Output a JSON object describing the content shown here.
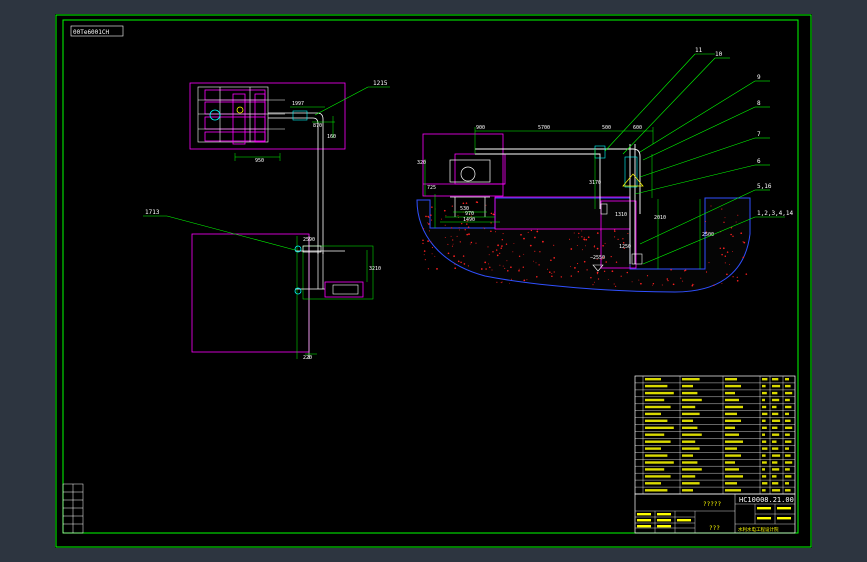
{
  "drawing": {
    "stamp": "00Те6001CH",
    "callouts": {
      "c11": "11",
      "c10": "10",
      "c9": "9",
      "c8": "8",
      "c7": "7",
      "c6": "6",
      "c516": "5,16",
      "c1214": "1,2,3,4,14",
      "c1215": "1215",
      "c1713": "1713"
    },
    "dims": {
      "d900": "900",
      "d5700": "5700",
      "d500": "500",
      "d600": "600",
      "d530": "530",
      "d970": "970",
      "d1490": "1490",
      "d3170": "3170",
      "d1310": "1310",
      "d2010": "2010",
      "d2500": "2500",
      "d1250": "1250",
      "d950": "950",
      "d1997": "1997",
      "d870": "870",
      "d320": "320",
      "d1250b": "−2550",
      "d725": "725",
      "d3210": "3210",
      "d220": "220",
      "d2590": "2590",
      "d160": "160"
    },
    "title_block": {
      "drawing_no": "HC10008.21.00",
      "name_placeholder": "?????",
      "bottom_placeholder": "???",
      "org_text": "水利水电工程设计院"
    },
    "colors": {
      "frame": "#00ff00",
      "magenta": "#ff00ff",
      "cyan": "#00ffff",
      "white": "#ffffff",
      "yellow": "#ffff00",
      "red": "#ff2020",
      "blue": "#3050ff"
    }
  }
}
